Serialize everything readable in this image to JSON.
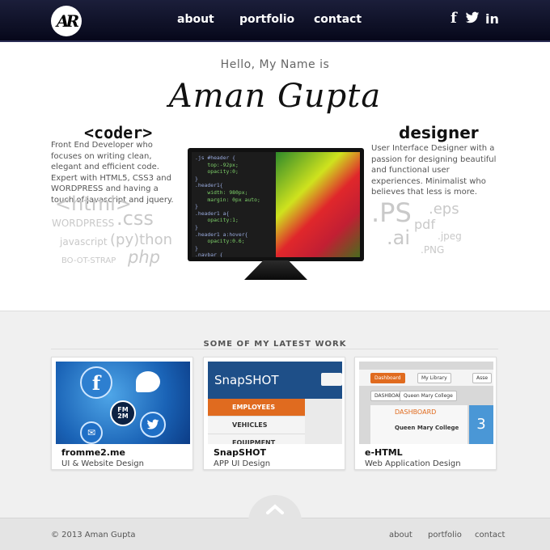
{
  "header": {
    "logo_text": "AR",
    "nav": [
      "about",
      "portfolio",
      "contact"
    ],
    "social": {
      "facebook": "f",
      "twitter": "t",
      "linkedin": "in"
    }
  },
  "hero": {
    "greeting": "Hello, My Name is",
    "name": "Aman Gupta",
    "coder": {
      "title": "<coder>",
      "description": "Front End Developer who focuses on writing clean, elegant and efficient code. Expert with HTML5, CSS3 and WORDPRESS and having a touch of javascript and jquery.",
      "tags": [
        "<html>",
        "WORDPRESS",
        ".css",
        "javascript",
        "(py)thon",
        "BO-OT-STRAP",
        "php"
      ]
    },
    "designer": {
      "title": "designer",
      "description": "User Interface Designer with a passion for designing beautiful and functional user experiences. Minimalist who believes that less is more.",
      "tags": [
        ".PS",
        ".eps",
        "pdf",
        ".ai",
        ".jpeg",
        ".PNG"
      ]
    },
    "code_lines": [
      ".js #header {",
      "    top:-92px;",
      "    opacity:0;",
      "}",
      ".header1{",
      "    width: 980px;",
      "    margin: 0px auto;",
      "}",
      ".header1 a{",
      "    opacity:1;",
      "}",
      ".header1 a:hover{",
      "    opacity:0.6;",
      "}",
      "",
      ".navbar {"
    ]
  },
  "work": {
    "heading": "SOME OF MY LATEST WORK",
    "projects": [
      {
        "title": "fromme2.me",
        "subtitle": "UI & Website Design",
        "badge": "FM 2M"
      },
      {
        "title": "SnapSHOT",
        "subtitle": "APP UI Design",
        "thumb_brand": "SnapSHOT",
        "thumb_menu": [
          "EMPLOYEES",
          "VEHICLES",
          "EQUIPMENT"
        ]
      },
      {
        "title": "e-HTML",
        "subtitle": "Web Application Design",
        "thumb_tabs": [
          "Dashboard",
          "My Library",
          "Asse"
        ],
        "thumb_crumbs": [
          "DASHBOARD",
          "Queen Mary College"
        ],
        "thumb_section": "DASHBOARD",
        "thumb_college": "Queen Mary College",
        "thumb_num": "3"
      }
    ]
  },
  "footer": {
    "copyright": "© 2013 Aman Gupta",
    "links": [
      "about",
      "portfolio",
      "contact"
    ]
  },
  "colors": {
    "header_bg": "#0d0f24",
    "accent_orange": "#e06b1f",
    "tag_gray": "#c9c9c9"
  }
}
